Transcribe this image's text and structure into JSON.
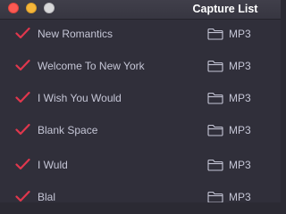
{
  "window": {
    "title": "Capture List",
    "controls": [
      "close",
      "minimize",
      "zoom"
    ]
  },
  "colors": {
    "background": "#302f3a",
    "text": "#c5c6d6",
    "check": "#e0374d",
    "title": "#ffffff"
  },
  "items": [
    {
      "name": "New Romantics",
      "format": "MP3",
      "checked": true
    },
    {
      "name": "Welcome To New York",
      "format": "MP3",
      "checked": true
    },
    {
      "name": "I Wish You Would",
      "format": "MP3",
      "checked": true
    },
    {
      "name": "Blank Space",
      "format": "MP3",
      "checked": true
    },
    {
      "name": "I Wuld",
      "format": "MP3",
      "checked": true
    },
    {
      "name": "Blal",
      "format": "MP3",
      "checked": true
    }
  ]
}
